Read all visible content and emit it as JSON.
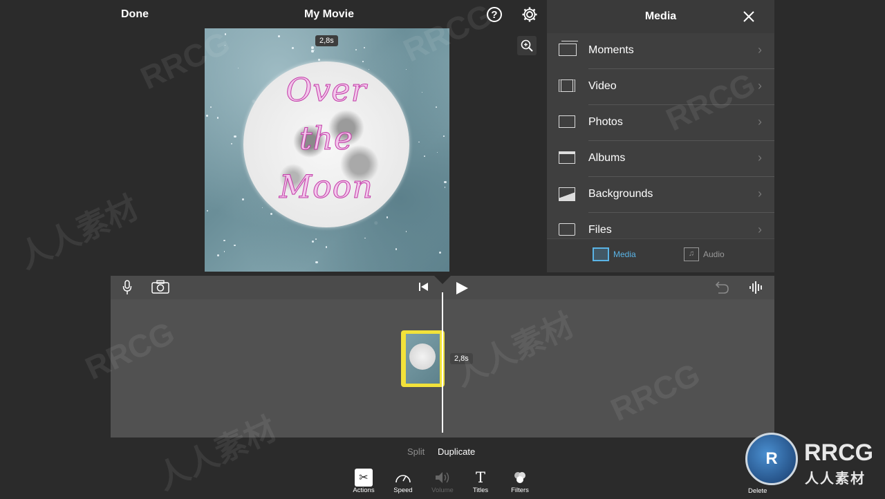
{
  "topbar": {
    "done_label": "Done",
    "title": "My Movie",
    "help_glyph": "?",
    "settings_icon": "gear-icon",
    "zoom_icon": "zoom-in-icon"
  },
  "preview": {
    "duration_badge": "2,8s",
    "text_line1": "Over",
    "text_line2": "the",
    "text_line3": "Moon"
  },
  "media_panel": {
    "title": "Media",
    "close_icon": "close-icon",
    "items": [
      {
        "label": "Moments",
        "icon": "moments-icon"
      },
      {
        "label": "Video",
        "icon": "film-icon"
      },
      {
        "label": "Photos",
        "icon": "photo-frame-icon"
      },
      {
        "label": "Albums",
        "icon": "albums-icon"
      },
      {
        "label": "Backgrounds",
        "icon": "backgrounds-icon"
      },
      {
        "label": "Files",
        "icon": "folder-icon"
      }
    ],
    "tabs": [
      {
        "label": "Media",
        "active": true,
        "color": "#5ab4e6"
      },
      {
        "label": "Audio",
        "active": false,
        "color": "#9a9a9a"
      }
    ]
  },
  "timeline": {
    "clip_duration": "2,8s",
    "tools_left": [
      "microphone-icon",
      "camera-icon"
    ],
    "tools_center": [
      "skip-back-icon",
      "play-icon"
    ],
    "tools_right": [
      "undo-icon",
      "waveform-icon"
    ]
  },
  "actions": {
    "split_label": "Split",
    "duplicate_label": "Duplicate"
  },
  "toolbar": {
    "items": [
      {
        "label": "Actions",
        "icon": "scissors-icon",
        "active": true
      },
      {
        "label": "Speed",
        "icon": "speedometer-icon",
        "active": false
      },
      {
        "label": "Volume",
        "icon": "speaker-icon",
        "active": false,
        "disabled": true
      },
      {
        "label": "Titles",
        "icon": "titles-icon",
        "active": false
      },
      {
        "label": "Filters",
        "icon": "filters-icon",
        "active": false
      }
    ],
    "delete_label": "Delete"
  },
  "watermark": {
    "latin": "RRCG",
    "cjk": "人人素材"
  },
  "colors": {
    "background": "#2b2b2b",
    "panel": "#3f3f3f",
    "timeline": "#515151",
    "clip_border": "#f2e23a",
    "accent": "#5ab4e6",
    "title_pink": "#f3c6ec"
  }
}
